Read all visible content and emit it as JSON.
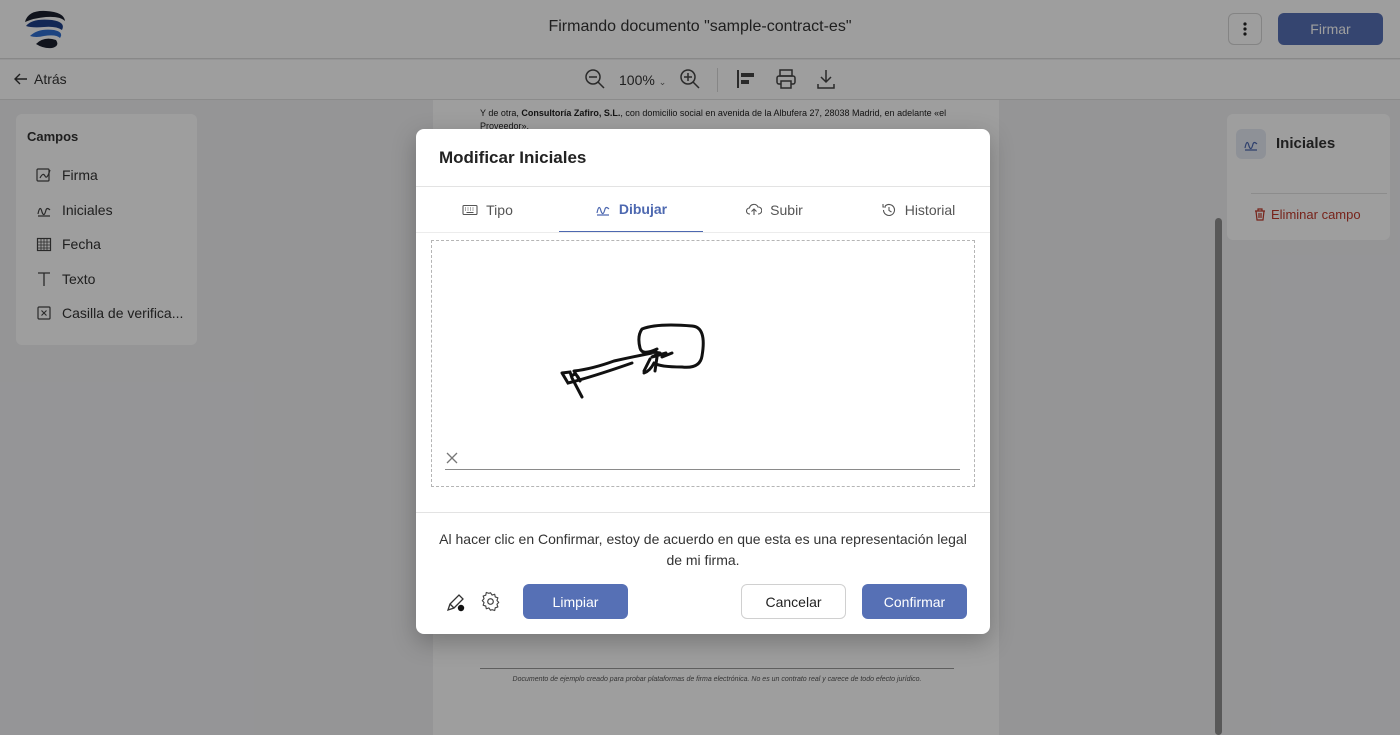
{
  "header": {
    "title": "Firmando documento \"sample-contract-es\"",
    "sign_label": "Firmar"
  },
  "toolbar": {
    "back_label": "Atrás",
    "zoom": "100%"
  },
  "fields_panel": {
    "title": "Campos",
    "items": [
      {
        "label": "Firma",
        "icon": "signature-icon"
      },
      {
        "label": "Iniciales",
        "icon": "initials-icon"
      },
      {
        "label": "Fecha",
        "icon": "calendar-icon"
      },
      {
        "label": "Texto",
        "icon": "text-icon"
      },
      {
        "label": "Casilla de verifica...",
        "icon": "checkbox-icon"
      }
    ]
  },
  "document": {
    "text_prefix": "Y de otra, ",
    "company": "Consultoría Zafiro, S.L.",
    "text_suffix": ", con domicilio social en avenida de la Albufera 27, 28038 Madrid, en adelante «el Proveedor».",
    "footer": "Documento de ejemplo creado para probar plataformas de firma electrónica. No es un contrato real y carece de todo efecto jurídico."
  },
  "right_panel": {
    "title": "Iniciales",
    "delete_label": "Eliminar campo"
  },
  "modal": {
    "title": "Modificar Iniciales",
    "tabs": [
      {
        "label": "Tipo",
        "icon": "keyboard-icon"
      },
      {
        "label": "Dibujar",
        "icon": "draw-icon"
      },
      {
        "label": "Subir",
        "icon": "upload-cloud-icon"
      },
      {
        "label": "Historial",
        "icon": "history-icon"
      }
    ],
    "active_tab": "Dibujar",
    "legal_text": "Al hacer clic en Confirmar, estoy de acuerdo en que esta es una representación legal de mi firma.",
    "clear_label": "Limpiar",
    "cancel_label": "Cancelar",
    "confirm_label": "Confirmar"
  },
  "colors": {
    "accent": "#5670b5",
    "danger": "#c0392b"
  }
}
